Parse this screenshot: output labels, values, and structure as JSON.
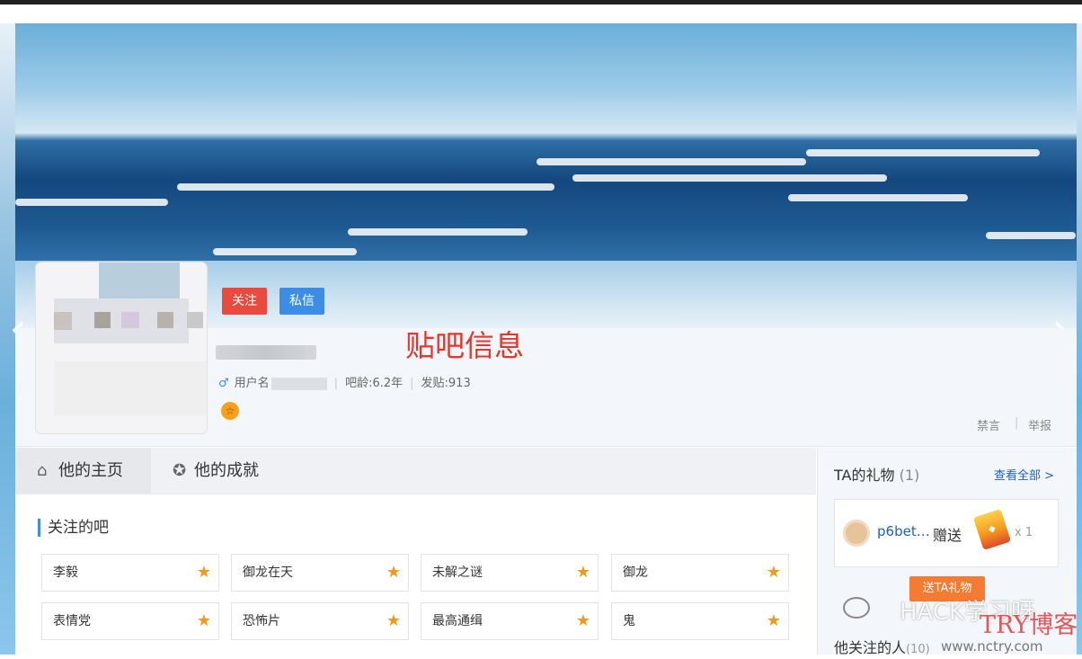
{
  "header": {
    "follow_label": "关注",
    "message_label": "私信"
  },
  "annotation": "贴吧信息",
  "profile": {
    "username_label": "用户名",
    "age_label": "吧龄:6.2年",
    "posts_label": "发贴:913",
    "gender_icon": "male-icon",
    "badge_icon": "honor-badge-icon"
  },
  "moderation": {
    "mute_label": "禁言",
    "report_label": "举报"
  },
  "tabs": [
    {
      "label": "他的主页",
      "icon": "home-icon"
    },
    {
      "label": "他的成就",
      "icon": "medal-icon"
    }
  ],
  "forums": {
    "title": "关注的吧",
    "items": [
      "李毅",
      "御龙在天",
      "未解之谜",
      "御龙",
      "表情党",
      "恐怖片",
      "最高通缉",
      "鬼"
    ]
  },
  "gifts": {
    "title": "TA的礼物",
    "count": "(1)",
    "see_all": "查看全部 >",
    "sender": "p6bet…",
    "verb": "赠送",
    "quantity": "x 1",
    "send_button": "送TA礼物"
  },
  "following": {
    "title": "他关注的人",
    "count": "(10)"
  },
  "watermark": {
    "text": "HACK学习呀",
    "brand": "TRY博客",
    "url": "www.nctry.com"
  },
  "colors": {
    "accent_blue": "#3b8de6",
    "follow_red": "#e84a3d",
    "gift_orange": "#f57a32",
    "annotation_red": "#e8352b"
  }
}
